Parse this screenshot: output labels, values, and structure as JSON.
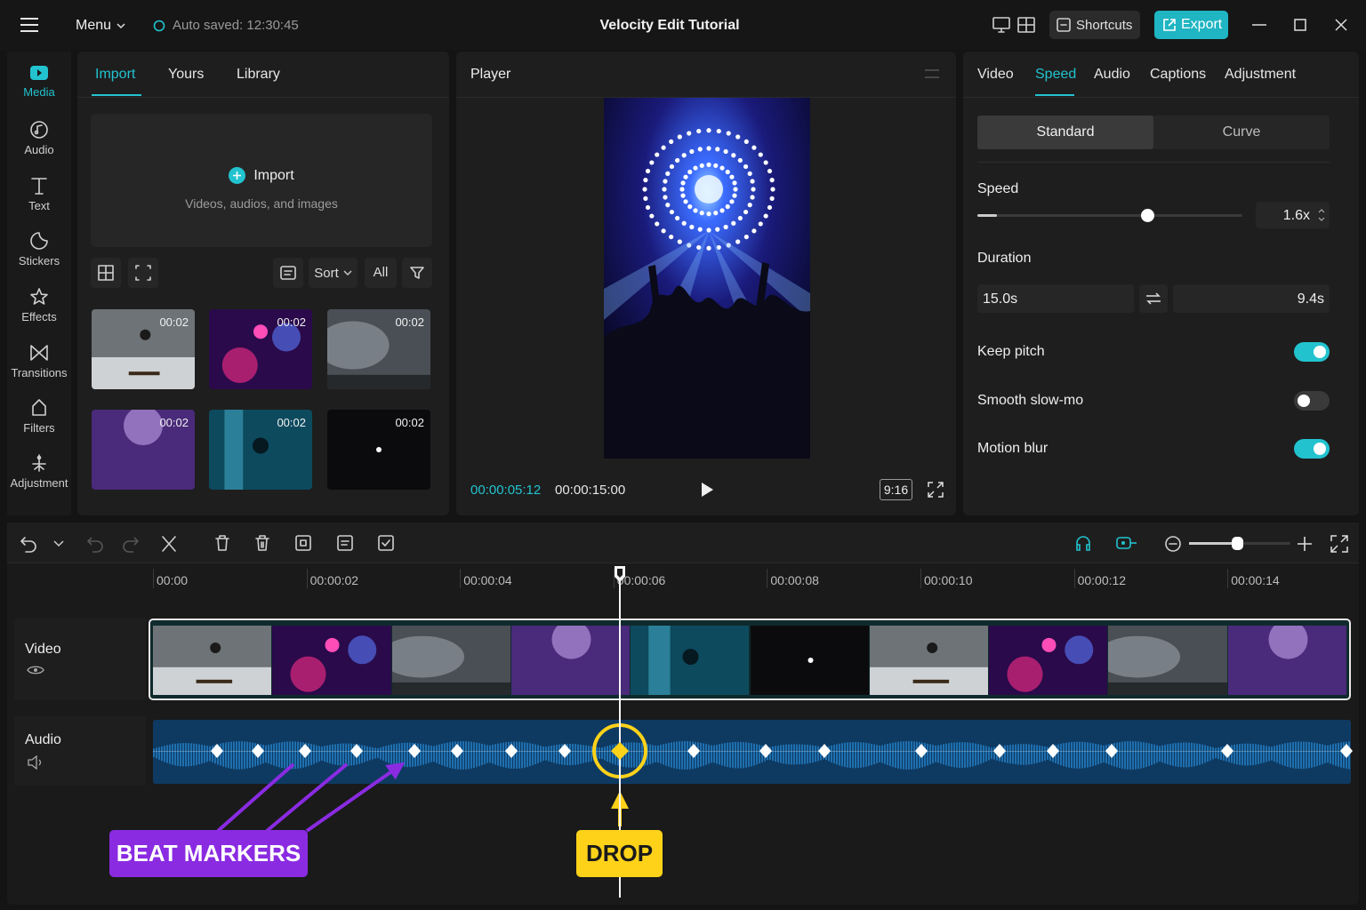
{
  "app": {
    "title": "Velocity Edit Tutorial",
    "menu_label": "Menu",
    "autosave": "Auto saved: 12:30:45",
    "shortcuts_label": "Shortcuts",
    "export_label": "Export",
    "accent": "#22c3cf"
  },
  "rail": {
    "items": [
      {
        "label": "Media",
        "icon": "media-icon",
        "active": true
      },
      {
        "label": "Audio",
        "icon": "music-note-icon"
      },
      {
        "label": "Text",
        "icon": "text-icon"
      },
      {
        "label": "Stickers",
        "icon": "sticker-icon"
      },
      {
        "label": "Effects",
        "icon": "star-icon"
      },
      {
        "label": "Transitions",
        "icon": "bowtie-icon"
      },
      {
        "label": "Filters",
        "icon": "filter-icon"
      },
      {
        "label": "Adjustment",
        "icon": "adjust-icon"
      }
    ]
  },
  "media": {
    "tabs": [
      "Import",
      "Yours",
      "Library"
    ],
    "import_label": "Import",
    "import_hint": "Videos, audios, and images",
    "sort_label": "Sort",
    "filter_all": "All",
    "clips": [
      {
        "duration": "00:02",
        "subject": "skateboarder"
      },
      {
        "duration": "00:02",
        "subject": "neon-figure"
      },
      {
        "duration": "00:02",
        "subject": "car-smoke"
      },
      {
        "duration": "00:02",
        "subject": "crowd-purple"
      },
      {
        "duration": "00:02",
        "subject": "silhouette-blue"
      },
      {
        "duration": "00:02",
        "subject": "tunnel-lights"
      }
    ]
  },
  "player": {
    "title": "Player",
    "current_time": "00:00:05:12",
    "total_time": "00:00:15:00",
    "aspect": "9:16"
  },
  "props": {
    "tabs": [
      "Video",
      "Speed",
      "Audio",
      "Captions",
      "Adjustment"
    ],
    "active_tab": "Speed",
    "modes": [
      "Standard",
      "Curve"
    ],
    "speed_label": "Speed",
    "speed_value": "1.6x",
    "speed_fraction": 0.64,
    "duration_label": "Duration",
    "duration_original": "15.0s",
    "duration_new": "9.4s",
    "toggles": [
      {
        "label": "Keep pitch",
        "on": true
      },
      {
        "label": "Smooth slow-mo",
        "on": false
      },
      {
        "label": "Motion blur",
        "on": true
      }
    ]
  },
  "timeline": {
    "ruler": [
      "00:00",
      "00:00:02",
      "00:00:04",
      "00:00:06",
      "00:00:08",
      "00:00:10",
      "00:00:12",
      "00:00:14"
    ],
    "video_track_label": "Video",
    "audio_track_label": "Audio",
    "zoom_fraction": 0.47,
    "frames": [
      "skateboarder",
      "neon-figure",
      "car-smoke",
      "crowd-purple",
      "silhouette-blue",
      "tunnel-lights",
      "skateboarder",
      "neon-figure",
      "car-smoke",
      "crowd-purple"
    ],
    "beat_marker_count": 20
  },
  "annotations": {
    "beat_markers_label": "BEAT MARKERS",
    "beat_markers_color": "#8a2be2",
    "drop_label": "DROP",
    "drop_color": "#ffd21a"
  }
}
